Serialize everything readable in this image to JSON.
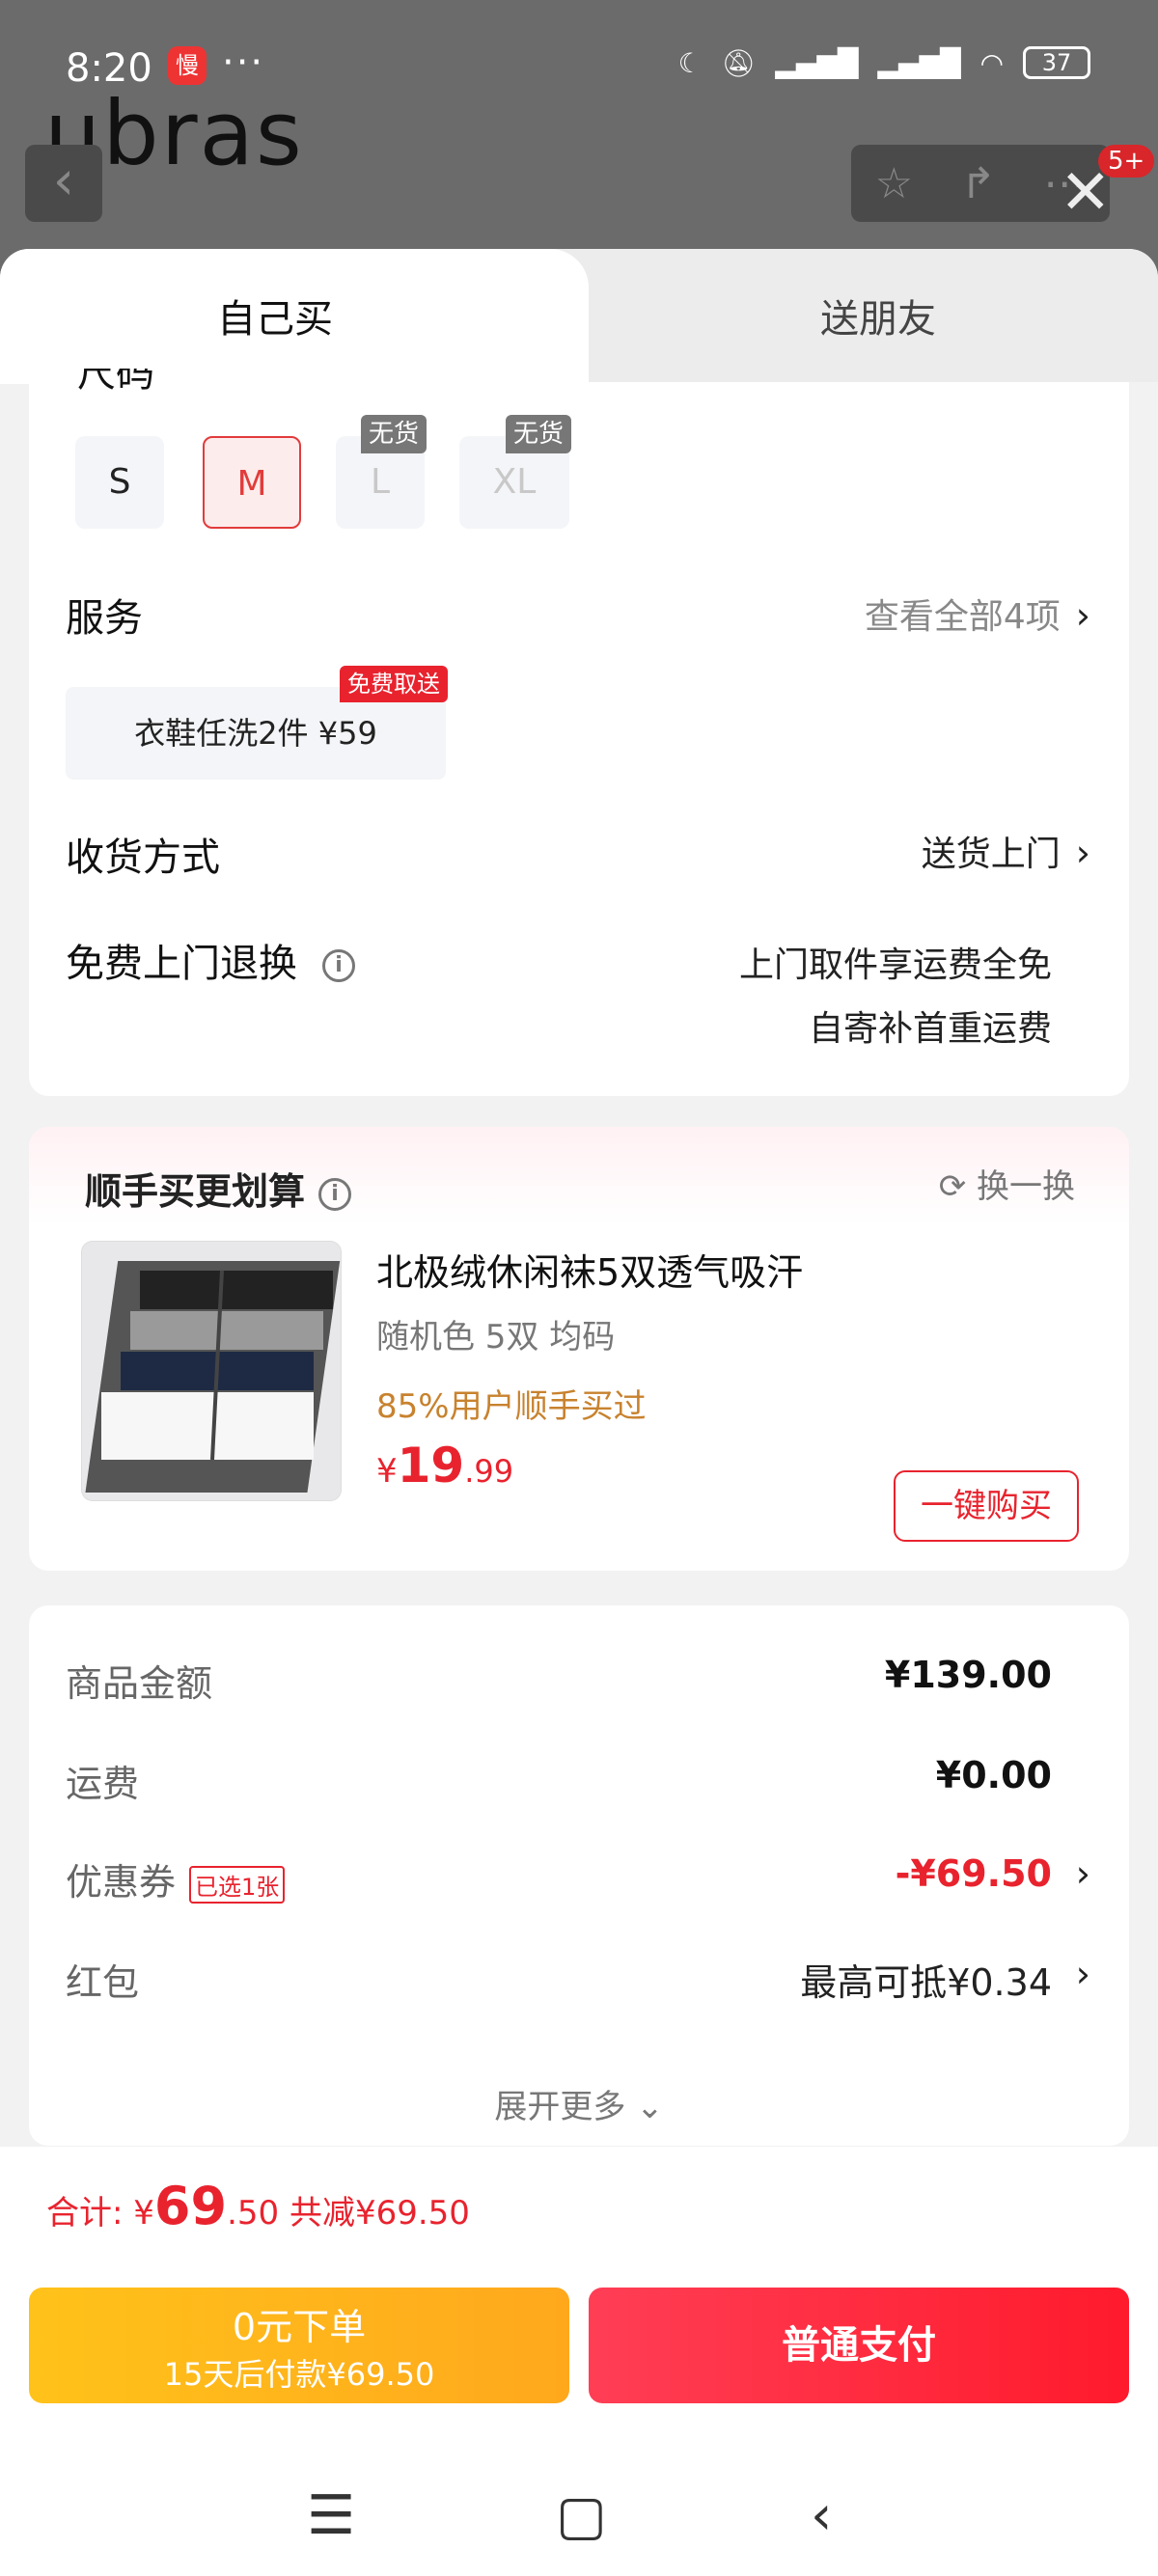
{
  "status_bar": {
    "time": "8:20",
    "app_badge": "慢",
    "battery": "37"
  },
  "background": {
    "brand": "ubras",
    "notification_count": "5+"
  },
  "tabs": [
    {
      "label": "自己买"
    },
    {
      "label": "送朋友"
    }
  ],
  "size": {
    "label_cut": "尺码",
    "options": [
      {
        "label": "S"
      },
      {
        "label": "M",
        "selected": true
      },
      {
        "label": "L",
        "tag": "无货"
      },
      {
        "label": "XL",
        "tag": "无货"
      }
    ]
  },
  "service": {
    "label": "服务",
    "link": "查看全部4项",
    "chip": {
      "text": "衣鞋任洗2件  ¥59",
      "tag": "免费取送"
    }
  },
  "delivery": {
    "label": "收货方式",
    "value": "送货上门"
  },
  "return": {
    "label": "免费上门退换",
    "line1": "上门取件享运费全免",
    "line2": "自寄补首重运费"
  },
  "recommend": {
    "title": "顺手买更划算",
    "refresh": "换一换",
    "product": {
      "name": "北极绒休闲袜5双透气吸汗",
      "spec": "随机色 5双   均码",
      "bought": "85%用户顺手买过",
      "price_symbol": "¥",
      "price_int": "19",
      "price_dec": ".99",
      "button": "一键购买"
    }
  },
  "summary": {
    "rows": [
      {
        "label": "商品金额",
        "value": "¥139.00"
      },
      {
        "label": "运费",
        "value": "¥0.00"
      },
      {
        "label": "优惠券",
        "tag": "已选1张",
        "value": "-¥69.50"
      },
      {
        "label": "红包",
        "value": "最高可抵¥0.34"
      }
    ],
    "expand": "展开更多"
  },
  "bottom": {
    "total_label": "合计: ¥",
    "total_int": "69",
    "total_dec": ".50",
    "discount": " 共减¥69.50",
    "pay_later_line1": "0元下单",
    "pay_later_line2": "15天后付款¥69.50",
    "pay_now": "普通支付"
  },
  "colors": {
    "accent": "#e8232e",
    "pay_later": "#ffb41a",
    "bought": "#c8822e"
  }
}
